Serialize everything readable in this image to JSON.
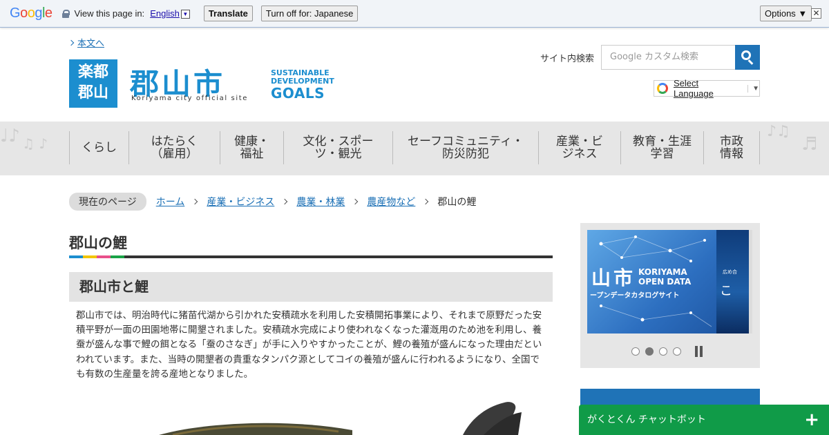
{
  "translate_bar": {
    "logo": "Google",
    "prompt": "View this page in:",
    "language": "English",
    "translate_button": "Translate",
    "turn_off_button": "Turn off for: Japanese",
    "options_button": "Options ▼",
    "close_icon": "close-icon"
  },
  "header": {
    "skip_link": "本文へ",
    "logo_box_line1": "楽都",
    "logo_box_line2": "郡山",
    "logo_main": "郡山市",
    "logo_sub": "Koriyama city official site",
    "sdgs_line1": "SUSTAINABLE",
    "sdgs_line2": "DEVELOPMENT",
    "sdgs_goals": "GOALS",
    "search_label": "サイト内検索",
    "search_placeholder": "Google カスタム検索",
    "select_language": "Select Language"
  },
  "nav": {
    "items": [
      {
        "label": "くらし"
      },
      {
        "label": "はたらく\n（雇用）"
      },
      {
        "label": "健康・\n福祉"
      },
      {
        "label": "文化・スポー\nツ・観光"
      },
      {
        "label": "セーフコミュニティ・\n防災防犯"
      },
      {
        "label": "産業・ビ\nジネス"
      },
      {
        "label": "教育・生涯\n学習"
      },
      {
        "label": "市政\n情報"
      }
    ]
  },
  "breadcrumb": {
    "current_label": "現在のページ",
    "links": [
      "ホーム",
      "産業・ビジネス",
      "農業・林業",
      "農産物など"
    ],
    "last": "郡山の鯉"
  },
  "main": {
    "title": "郡山の鯉",
    "section_heading": "郡山市と鯉",
    "body": "郡山市では、明治時代に猪苗代湖から引かれた安積疏水を利用した安積開拓事業により、それまで原野だった安積平野が一面の田園地帯に開墾されました。安積疏水完成により使われなくなった灌漑用のため池を利用し、養蚕が盛んな事で鯉の餌となる「蚕のさなぎ」が手に入りやすかったことが、鯉の養殖が盛んになった理由だといわれています。また、当時の開墾者の貴重なタンパク源としてコイの養殖が盛んに行われるようになり、全国でも有数の生産量を誇る産地となりました。"
  },
  "sidebar": {
    "slide_kanji": "山市",
    "slide_en_line1": "KORIYAMA",
    "slide_en_line2": "OPEN DATA",
    "slide_jp": "ープンデータカタログサイト",
    "slide_right_small": "広め合",
    "slide_right_text": "こ"
  },
  "chatbot": {
    "label": "がくとくん チャットボット",
    "plus": "+"
  },
  "colors": {
    "brand_blue": "#1c8ecf",
    "search_blue": "#1f73b7",
    "chatbot_green": "#109b48",
    "rule_colors": [
      "#1c8ecf",
      "#f2c500",
      "#e8508a",
      "#1aa346"
    ]
  }
}
